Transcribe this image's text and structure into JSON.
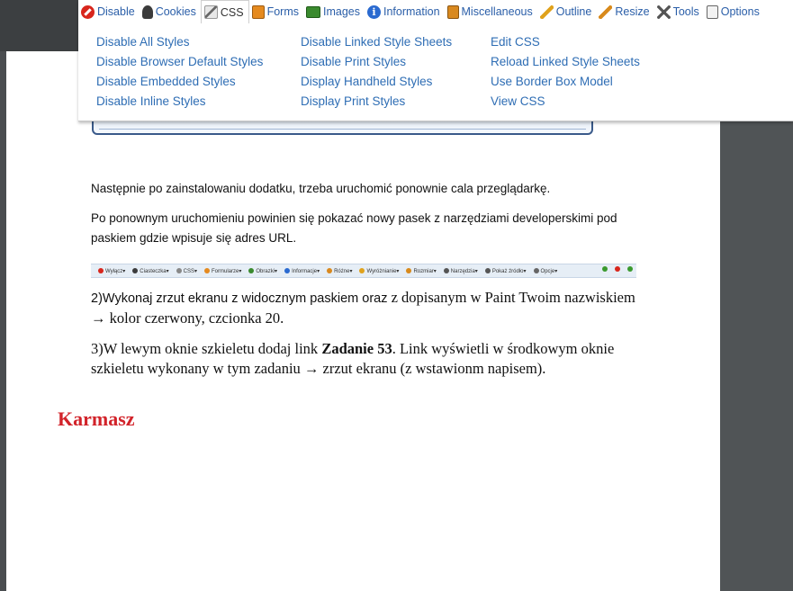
{
  "toolbar": {
    "tabs": [
      {
        "label": "Disable",
        "icon": "disable-icon"
      },
      {
        "label": "Cookies",
        "icon": "cookies-icon"
      },
      {
        "label": "CSS",
        "icon": "css-icon"
      },
      {
        "label": "Forms",
        "icon": "forms-icon"
      },
      {
        "label": "Images",
        "icon": "images-icon"
      },
      {
        "label": "Information",
        "icon": "information-icon"
      },
      {
        "label": "Miscellaneous",
        "icon": "miscellaneous-icon"
      },
      {
        "label": "Outline",
        "icon": "outline-icon"
      },
      {
        "label": "Resize",
        "icon": "resize-icon"
      },
      {
        "label": "Tools",
        "icon": "tools-icon"
      },
      {
        "label": "Options",
        "icon": "options-icon"
      }
    ],
    "active_tab": "CSS"
  },
  "css_menu": {
    "col1": [
      "Disable All Styles",
      "Disable Browser Default Styles",
      "Disable Embedded Styles",
      "Disable Inline Styles"
    ],
    "col2": [
      "Disable Linked Style Sheets",
      "Disable Print Styles",
      "Display Handheld Styles",
      "Display Print Styles"
    ],
    "col3": [
      "Edit CSS",
      "Reload Linked Style Sheets",
      "Use Border Box Model",
      "View CSS"
    ]
  },
  "document": {
    "p1": "Następnie po zainstalowaniu dodatku, trzeba uruchomić ponownie cala przeglądarkę.",
    "p2": "Po ponownym uruchomieniu powinien się pokazać nowy pasek z narzędziami developerskimi pod paskiem gdzie wpisuje się adres URL.",
    "mini_toolbar": [
      "Wyłącz",
      "Ciasteczka",
      "CSS",
      "Formularze",
      "Obrazki",
      "Informacje",
      "Różne",
      "Wyróżnianie",
      "Rozmiar",
      "Narzędzia",
      "Pokaż źródło",
      "Opcje"
    ],
    "task2_a": "2)Wykonaj zrzut ekranu z widocznym paskiem oraz",
    "task2_b": " z dopisanym w Paint Twoim nazwiskiem → kolor czerwony, czcionka 20.",
    "task3_a": "3)W lewym oknie szkieletu dodaj link ",
    "task3_bold": "Zadanie 53",
    "task3_b": ". Link wyświetli w środkowym oknie szkieletu wykonany w tym zadaniu → zrzut ekranu (z wstawionm napisem).",
    "surname": "Karmasz"
  },
  "colors": {
    "link": "#2e6db4",
    "surname": "#d2232a",
    "background": "#4a4d50"
  }
}
